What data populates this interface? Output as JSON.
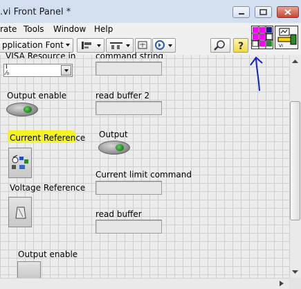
{
  "window": {
    "title": ".vi Front Panel *",
    "controls": [
      "minimize-icon",
      "maximize-icon",
      "close-icon"
    ]
  },
  "menubar": {
    "items": [
      {
        "label": "rate"
      },
      {
        "label": "Tools"
      },
      {
        "label": "Window"
      },
      {
        "label": "Help"
      }
    ]
  },
  "toolbar": {
    "font_select": "pplication Font",
    "buttons": [
      "align-objects-icon",
      "distribute-objects-icon",
      "resize-objects-icon",
      "reorder-icon",
      "search-icon",
      "help-icon"
    ],
    "connector_pane_icon": "connector-pane-icon",
    "vi_icon": "vi-icon"
  },
  "annotation": {
    "arrow_color": "#1020c8",
    "highlight_color": "#f4f41a"
  },
  "panel": {
    "visa": {
      "label": "VISA Resource in",
      "value": ""
    },
    "command_string": {
      "label": "command string"
    },
    "output_enable_1": {
      "label": "Output enable"
    },
    "read_buffer_2": {
      "label": "read buffer 2"
    },
    "current_reference": {
      "label": "Current Reference"
    },
    "output": {
      "label": "Output"
    },
    "current_limit": {
      "label": "Current limit command"
    },
    "voltage_reference": {
      "label": "Voltage Reference"
    },
    "read_buffer": {
      "label": "read buffer"
    },
    "output_enable_2": {
      "label": "Output enable"
    }
  },
  "colors": {
    "led_green": "#2aa52a",
    "titlebar": "#d3dfee"
  }
}
